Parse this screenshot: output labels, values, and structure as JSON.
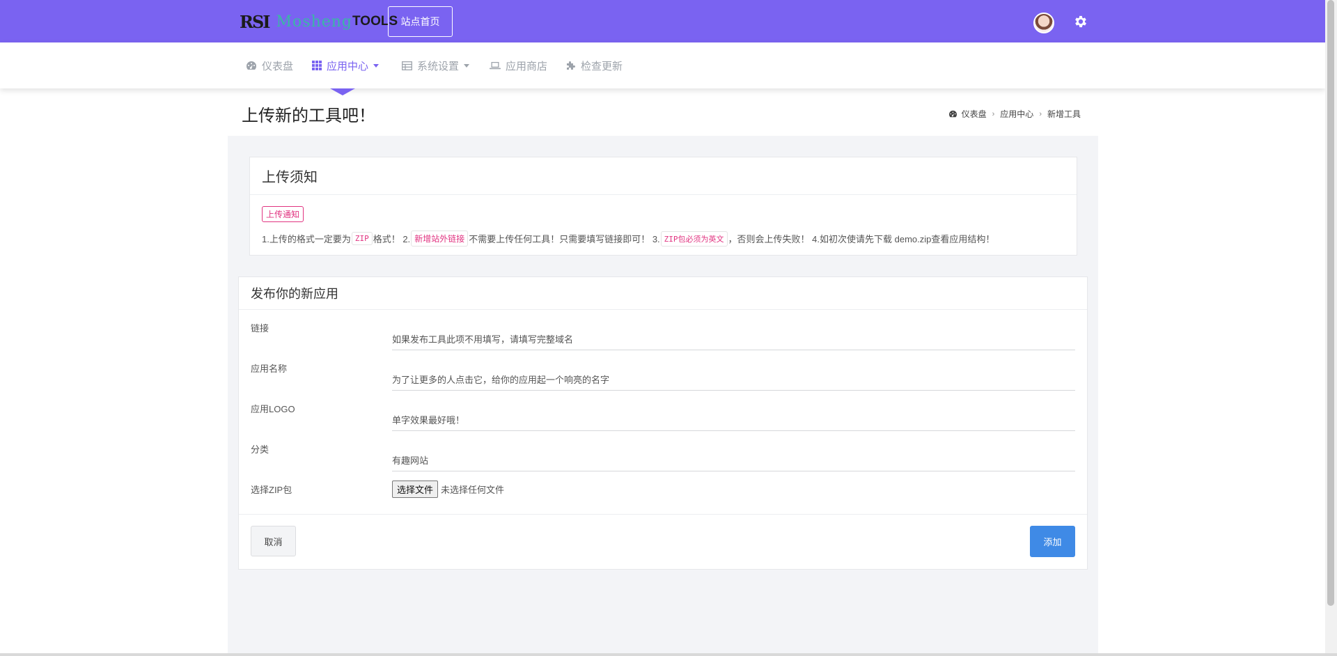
{
  "header": {
    "brand_mark": "RSI",
    "brand_word": "Mosheng",
    "brand_suffix": "TOOLS",
    "site_home_button": "站点首页",
    "accent_color": "#7a63f1"
  },
  "nav": {
    "items": [
      {
        "label": "仪表盘",
        "icon": "dashboard-icon",
        "active": false
      },
      {
        "label": "应用中心",
        "icon": "grid-icon",
        "active": true,
        "dropdown": true
      },
      {
        "label": "系统设置",
        "icon": "table-icon",
        "active": false,
        "dropdown": true
      },
      {
        "label": "应用商店",
        "icon": "laptop-icon",
        "active": false
      },
      {
        "label": "检查更新",
        "icon": "puzzle-icon",
        "active": false
      }
    ]
  },
  "page": {
    "title": "上传新的工具吧！",
    "breadcrumb": [
      "仪表盘",
      "应用中心",
      "新增工具"
    ]
  },
  "notice_card": {
    "title": "上传须知",
    "badge": "上传通知",
    "part1": "1.上传的格式一定要为",
    "code_zip": "ZIP",
    "part2": "格式！ 2.",
    "tag_external": "新增站外链接",
    "part3": "不需要上传任何工具！只需要填写链接即可！ 3.",
    "code_zip_en": "ZIP包必须为英文",
    "part4": "，否则会上传失败！ 4.如初次使请先下载 demo.zip查看应用结构！"
  },
  "form_card": {
    "title": "发布你的新应用",
    "fields": [
      {
        "label": "链接",
        "placeholder": "如果发布工具此项不用填写，请填写完整域名"
      },
      {
        "label": "应用名称",
        "placeholder": "为了让更多的人点击它，给你的应用起一个响亮的名字"
      },
      {
        "label": "应用LOGO",
        "placeholder": "单字效果最好哦！"
      },
      {
        "label": "分类",
        "placeholder": "有趣网站"
      }
    ],
    "file_label": "选择ZIP包",
    "file_button": "选择文件",
    "file_status": "未选择任何文件",
    "cancel": "取消",
    "submit": "添加",
    "submit_color": "#3f8ae6"
  }
}
